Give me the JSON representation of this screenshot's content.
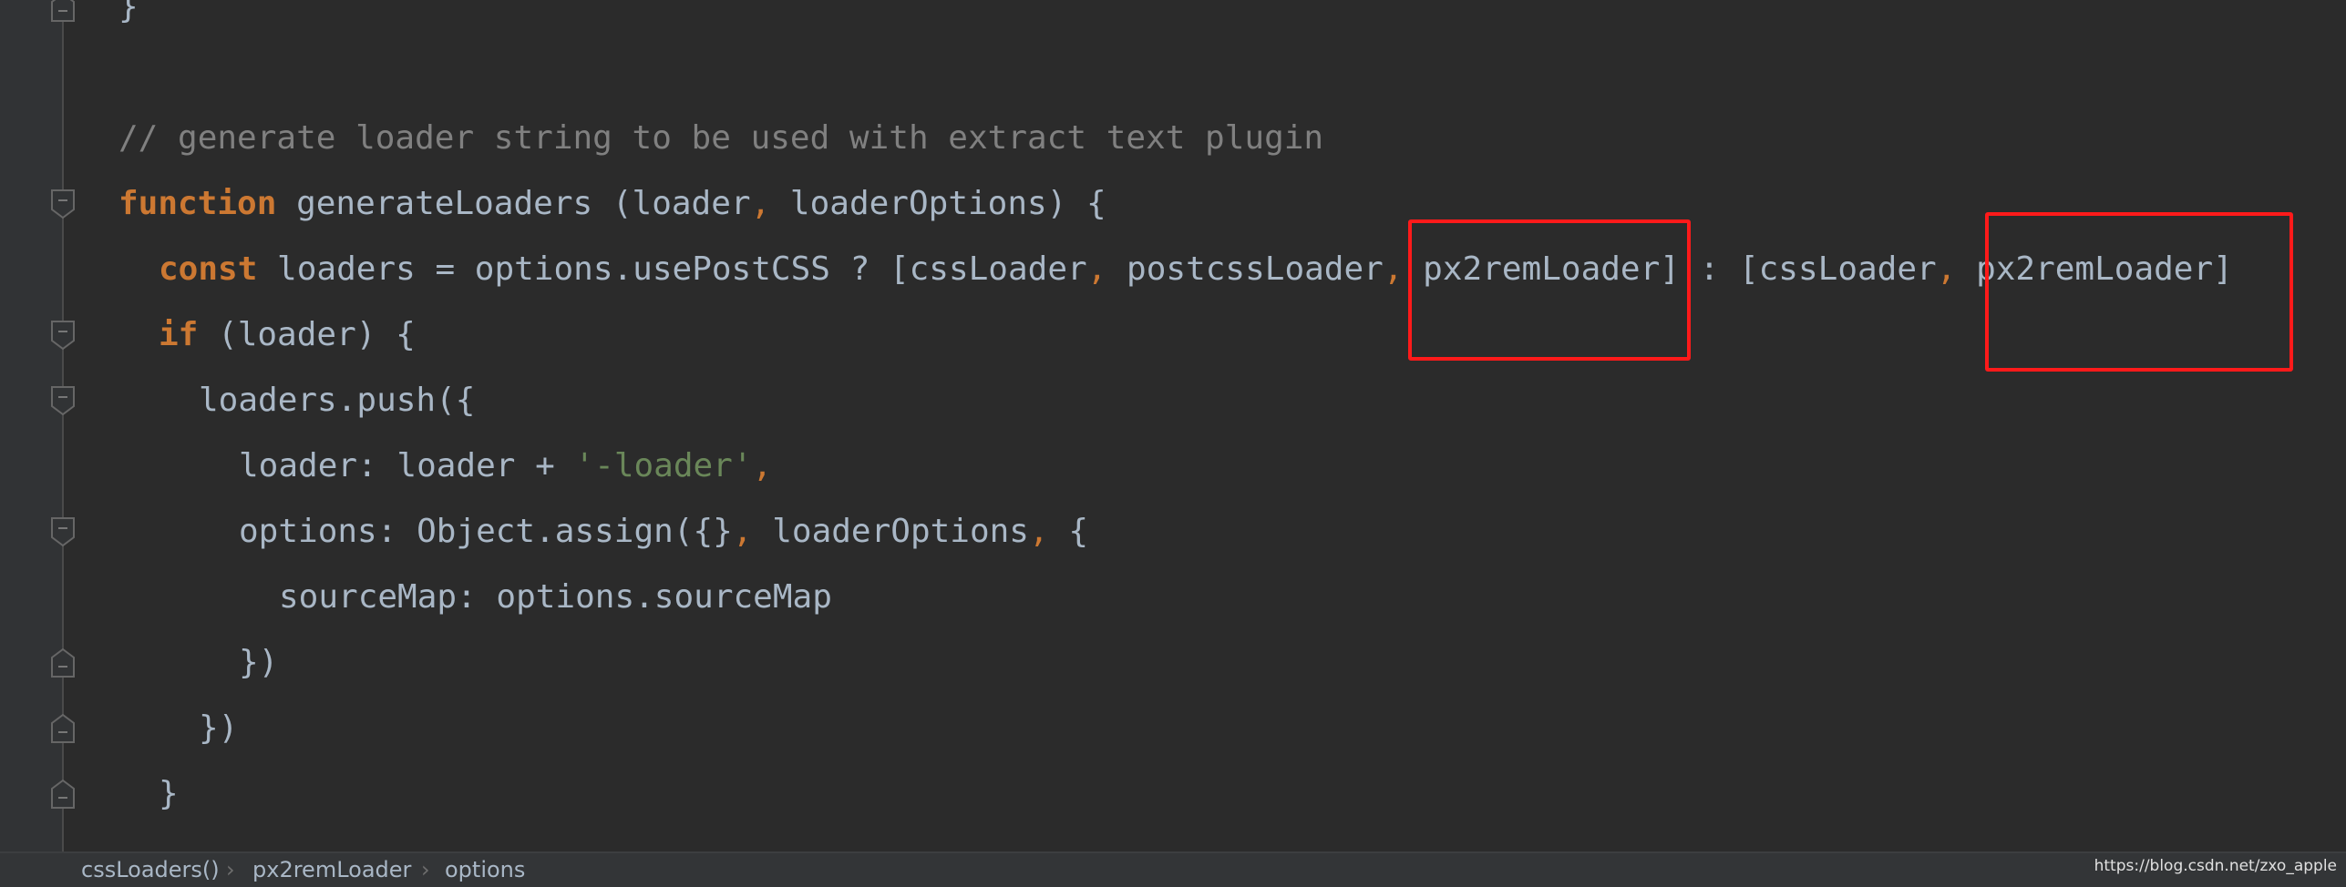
{
  "editor": {
    "lines": [
      {
        "indent": 0,
        "tokens": [
          {
            "t": "}",
            "c": ""
          }
        ]
      },
      {
        "indent": 0,
        "tokens": []
      },
      {
        "indent": 0,
        "tokens": [
          {
            "t": "// generate loader string to be used with extract text plugin",
            "c": "cm"
          }
        ]
      },
      {
        "indent": 0,
        "tokens": [
          {
            "t": "function",
            "c": "kw"
          },
          {
            "t": " generateLoaders (loader",
            "c": ""
          },
          {
            "t": ",",
            "c": "pn"
          },
          {
            "t": " loaderOptions) {",
            "c": ""
          }
        ]
      },
      {
        "indent": 1,
        "tokens": [
          {
            "t": "const",
            "c": "kw"
          },
          {
            "t": " loaders = options.usePostCSS ? [cssLoader",
            "c": ""
          },
          {
            "t": ",",
            "c": "pn"
          },
          {
            "t": " postcssLoader",
            "c": ""
          },
          {
            "t": ",",
            "c": "pn"
          },
          {
            "t": " px2remLoader] : [cssLoader",
            "c": ""
          },
          {
            "t": ",",
            "c": "pn"
          },
          {
            "t": " px2remLoader]",
            "c": ""
          }
        ]
      },
      {
        "indent": 1,
        "tokens": [
          {
            "t": "if",
            "c": "kw"
          },
          {
            "t": " (loader) {",
            "c": ""
          }
        ]
      },
      {
        "indent": 2,
        "tokens": [
          {
            "t": "loaders.push({",
            "c": ""
          }
        ]
      },
      {
        "indent": 3,
        "tokens": [
          {
            "t": "loader: loader + ",
            "c": ""
          },
          {
            "t": "'-loader'",
            "c": "st"
          },
          {
            "t": ",",
            "c": "pn"
          }
        ]
      },
      {
        "indent": 3,
        "tokens": [
          {
            "t": "options: Object.assign({}",
            "c": ""
          },
          {
            "t": ",",
            "c": "pn"
          },
          {
            "t": " loaderOptions",
            "c": ""
          },
          {
            "t": ",",
            "c": "pn"
          },
          {
            "t": " {",
            "c": ""
          }
        ]
      },
      {
        "indent": 4,
        "tokens": [
          {
            "t": "sourceMap: options.sourceMap",
            "c": ""
          }
        ]
      },
      {
        "indent": 3,
        "tokens": [
          {
            "t": "})",
            "c": ""
          }
        ]
      },
      {
        "indent": 2,
        "tokens": [
          {
            "t": "})",
            "c": ""
          }
        ]
      },
      {
        "indent": 1,
        "tokens": [
          {
            "t": "}",
            "c": ""
          }
        ]
      }
    ],
    "fold_markers": [
      {
        "line": 0,
        "type": "end"
      },
      {
        "line": 3,
        "type": "start"
      },
      {
        "line": 5,
        "type": "start"
      },
      {
        "line": 6,
        "type": "start"
      },
      {
        "line": 8,
        "type": "start"
      },
      {
        "line": 10,
        "type": "end"
      },
      {
        "line": 11,
        "type": "end"
      },
      {
        "line": 12,
        "type": "end"
      }
    ],
    "highlight_color": "#ff1a1a"
  },
  "breadcrumb": [
    "cssLoaders()",
    "px2remLoader",
    "options"
  ],
  "watermark": "https://blog.csdn.net/zxo_apple"
}
